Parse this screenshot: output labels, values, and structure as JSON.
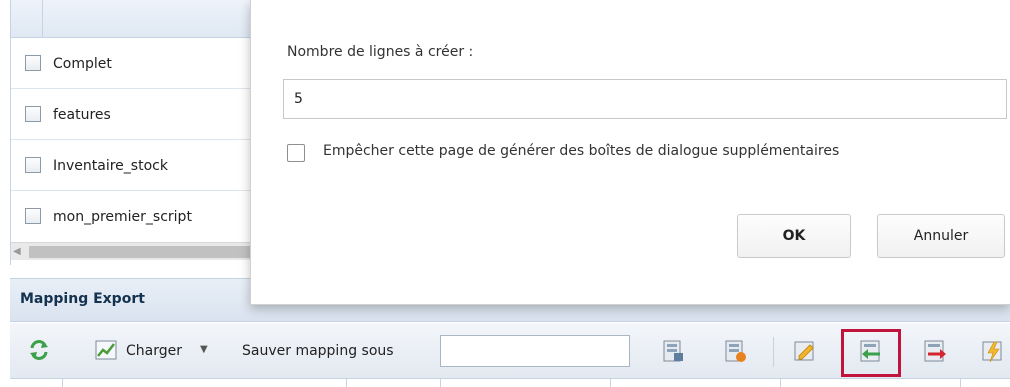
{
  "list": {
    "items": [
      {
        "label": "Complet"
      },
      {
        "label": "features"
      },
      {
        "label": "Inventaire_stock"
      },
      {
        "label": "mon_premier_script"
      }
    ]
  },
  "mapping_export": {
    "title": "Mapping Export"
  },
  "toolbar": {
    "charger_label": "Charger",
    "sauver_label": "Sauver mapping sous",
    "input_value": ""
  },
  "dialog": {
    "prompt": "Nombre de lignes à créer :",
    "value": "5",
    "suppress_label": "Empêcher cette page de générer des boîtes de dialogue supplémentaires",
    "ok_label": "OK",
    "cancel_label": "Annuler"
  },
  "colors": {
    "highlight": "#c0143c",
    "header_text": "#15324f"
  }
}
